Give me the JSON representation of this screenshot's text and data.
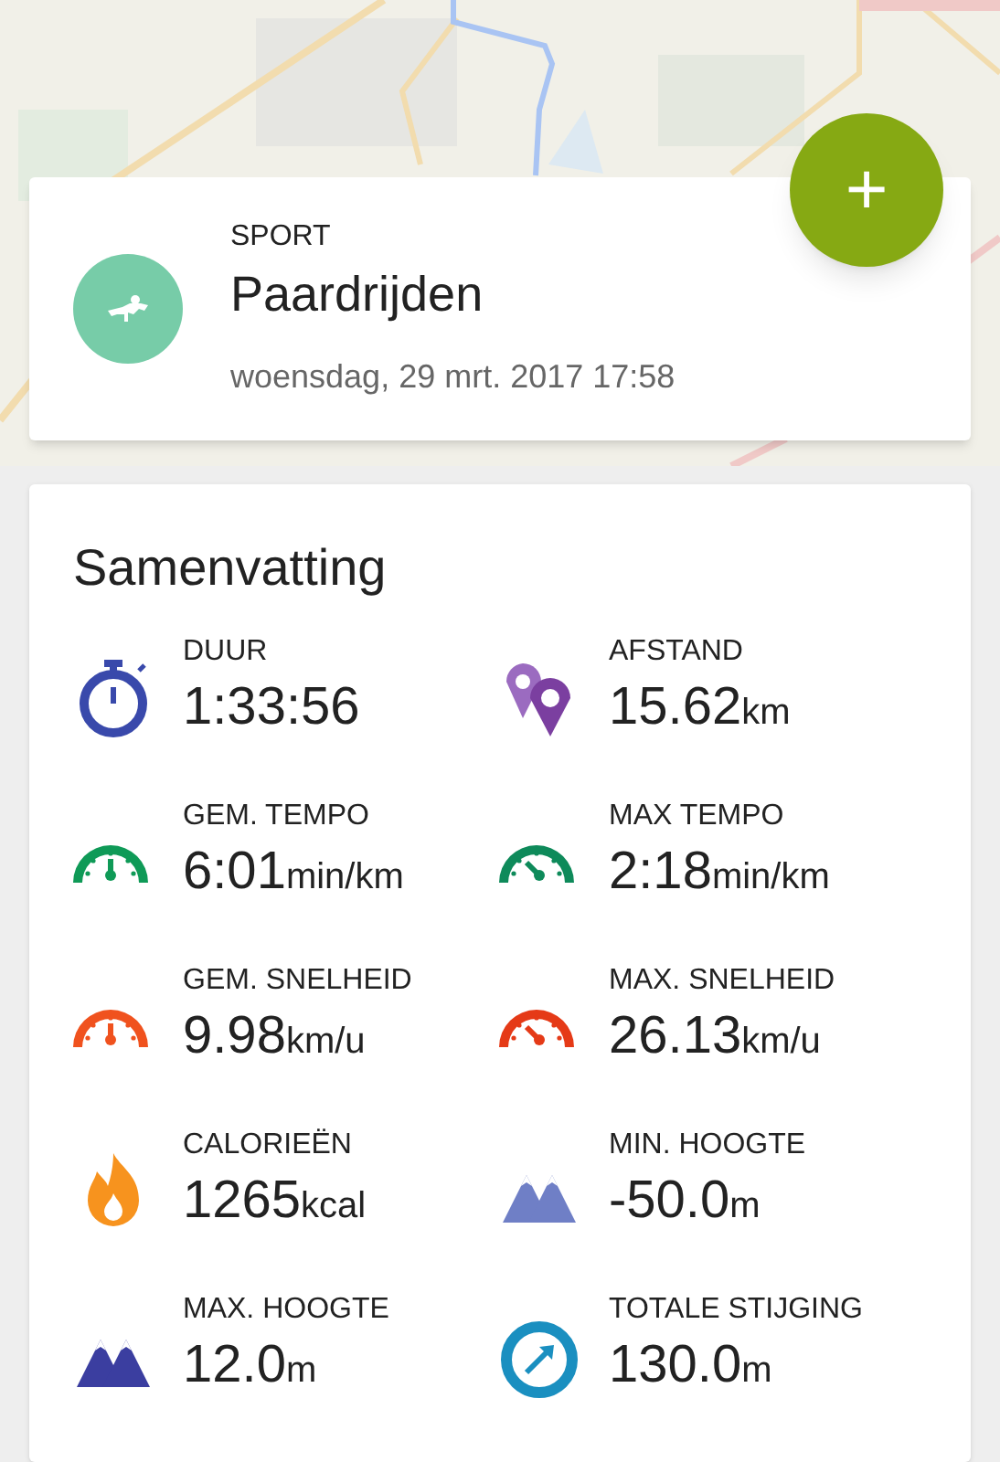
{
  "activity": {
    "label": "SPORT",
    "name": "Paardrijden",
    "date": "woensdag, 29 mrt. 2017 17:58"
  },
  "add_button": {
    "label": "+"
  },
  "summary": {
    "title": "Samenvatting",
    "stats": [
      {
        "kind": "stopwatch",
        "color": "#3949ab",
        "label": "DUUR",
        "value": "1:33:56"
      },
      {
        "kind": "pins",
        "color": "#7b3fa0",
        "label": "AFSTAND",
        "value": "15.62",
        "unit": "km"
      },
      {
        "kind": "gauge-avg",
        "color": "#0f9a57",
        "label": "GEM. TEMPO",
        "value": "6:01",
        "unit": "min/km"
      },
      {
        "kind": "gauge-max",
        "color": "#0e8a5a",
        "label": "MAX TEMPO",
        "value": "2:18",
        "unit": "min/km"
      },
      {
        "kind": "gauge-avg",
        "color": "#f0521e",
        "label": "GEM. SNELHEID",
        "value": "9.98",
        "unit": "km/u"
      },
      {
        "kind": "gauge-max",
        "color": "#e53a17",
        "label": "MAX. SNELHEID",
        "value": "26.13",
        "unit": "km/u"
      },
      {
        "kind": "flame",
        "color": "#f7931e",
        "label": "CALORIEËN",
        "value": "1265",
        "unit": "kcal"
      },
      {
        "kind": "mountains",
        "color": "#6f7fc6",
        "label": "MIN. HOOGTE",
        "value": "-50.0",
        "unit": "m"
      },
      {
        "kind": "mountains",
        "color": "#3b3ea0",
        "label": "MAX. HOOGTE",
        "value": "12.0",
        "unit": "m"
      },
      {
        "kind": "ascent",
        "color": "#1a8fc0",
        "label": "TOTALE STIJGING",
        "value": "130.0",
        "unit": "m"
      }
    ]
  }
}
